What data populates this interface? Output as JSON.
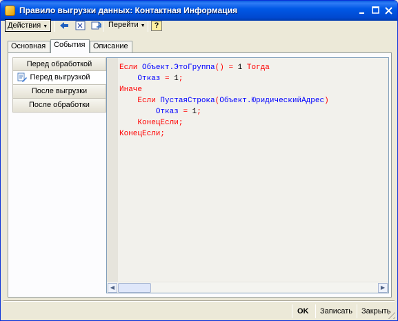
{
  "window": {
    "title": "Правило выгрузки данных: Контактная Информация"
  },
  "toolbar": {
    "actions_label": "Действия",
    "goto_label": "Перейти",
    "help_label": "?"
  },
  "tabs": [
    {
      "label": "Основная",
      "active": false
    },
    {
      "label": "События",
      "active": true
    },
    {
      "label": "Описание",
      "active": false
    }
  ],
  "events": [
    {
      "label": "Перед обработкой",
      "active": false
    },
    {
      "label": "Перед выгрузкой",
      "active": true
    },
    {
      "label": "После выгрузки",
      "active": false
    },
    {
      "label": "После обработки",
      "active": false
    }
  ],
  "code": {
    "line1": {
      "indent": "",
      "kw1": "Если",
      "obj": "Объект.ЭтоГруппа",
      "paren": "()",
      "eq": "=",
      "num": "1",
      "kw2": "Тогда"
    },
    "line2": {
      "indent": "    ",
      "name": "Отказ",
      "eq": "=",
      "num": "1",
      "semi": ";"
    },
    "line3": {
      "kw": "Иначе"
    },
    "line4": {
      "indent": "    ",
      "kw": "Если",
      "func": "ПустаяСтрока",
      "paren": "(",
      "arg": "Объект.ЮридическийАдрес",
      "rparen": ")"
    },
    "line5": {
      "indent": "        ",
      "name": "Отказ",
      "eq": "=",
      "num": "1",
      "semi": ";"
    },
    "line6": {
      "indent": "    ",
      "kw": "КонецЕсли;"
    },
    "line7": {
      "kw": "КонецЕсли;"
    }
  },
  "footer": {
    "ok_label": "OK",
    "save_label": "Записать",
    "close_label": "Закрыть"
  },
  "colors": {
    "keyword": "#ff0000",
    "identifier": "#0000ff",
    "titlebar": "#0058e6"
  }
}
